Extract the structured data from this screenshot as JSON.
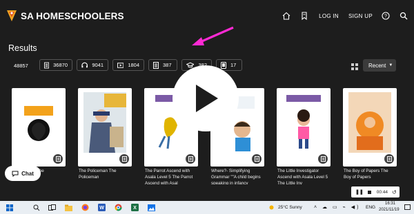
{
  "header": {
    "brand": "SA HOMESCHOOLERS",
    "login": "LOG IN",
    "signup": "SIGN UP"
  },
  "results": {
    "title": "Results",
    "total": "48857",
    "filters": [
      {
        "icon": "document-icon",
        "count": "36870"
      },
      {
        "icon": "headphones-icon",
        "count": "9041"
      },
      {
        "icon": "video-icon",
        "count": "1804"
      },
      {
        "icon": "document-icon",
        "count": "387"
      },
      {
        "icon": "graduation-cap-icon",
        "count": "382"
      },
      {
        "icon": "tablet-icon",
        "count": "17"
      }
    ],
    "sort": "Recent"
  },
  "cards": [
    {
      "title_lines": [
        "ry The",
        ""
      ]
    },
    {
      "title_lines": [
        "The Policeman The",
        "Policeman"
      ]
    },
    {
      "title_lines": [
        "The Parrot Ascend with",
        "Asala Level 5 The Parrot",
        "Ascend with Asal"
      ]
    },
    {
      "title_lines": [
        "Where?- Simplifying",
        "Grammar \"\"A child begins",
        "speaking in infancy"
      ]
    },
    {
      "title_lines": [
        "The Little Investigator",
        "Ascend with Asala Level 5",
        "The Little Inv"
      ]
    },
    {
      "title_lines": [
        "The Boy of Papers The",
        "Boy of Papers"
      ]
    }
  ],
  "chat": {
    "label": "Chat"
  },
  "recorder": {
    "time": "00:44"
  },
  "taskbar": {
    "weather": "25°C  Sunny",
    "lang": "ENG",
    "time": "16:31",
    "date": "2021/11/19"
  },
  "colors": {
    "brand": "#f5a623",
    "accent_arrow": "#ff2ad4",
    "background": "#1d1d1d"
  }
}
